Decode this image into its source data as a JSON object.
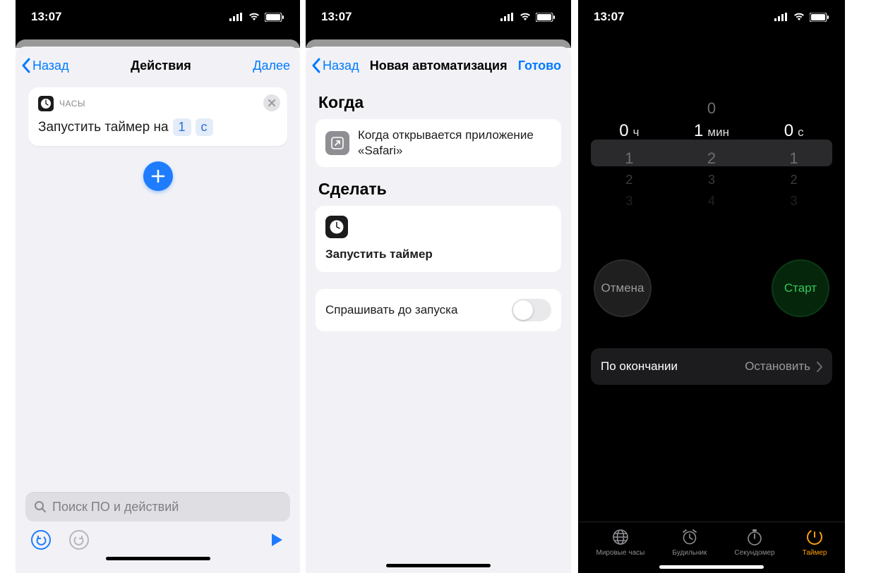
{
  "status": {
    "time": "13:07"
  },
  "screen1": {
    "nav": {
      "back": "Назад",
      "title": "Действия",
      "next": "Далее"
    },
    "card": {
      "app_label": "ЧАСЫ",
      "action_prefix": "Запустить таймер на",
      "param_value": "1",
      "param_unit": "с"
    },
    "search_placeholder": "Поиск ПО и действий"
  },
  "screen2": {
    "nav": {
      "back": "Назад",
      "title": "Новая автоматизация",
      "done": "Готово"
    },
    "when_header": "Когда",
    "when_text": "Когда открывается приложение «Safari»",
    "do_header": "Сделать",
    "do_action": "Запустить таймер",
    "ask_label": "Спрашивать до запуска"
  },
  "screen3": {
    "picker": {
      "hours_unit": "ч",
      "mins_unit": "мин",
      "secs_unit": "с",
      "hours_val": "0",
      "mins_val": "1",
      "secs_val": "0",
      "mins_above": "0",
      "h_below1": "1",
      "h_below2": "2",
      "h_below3": "3",
      "m_below1": "2",
      "m_below2": "3",
      "m_below3": "4",
      "s_below1": "1",
      "s_below2": "2",
      "s_below3": "3"
    },
    "cancel": "Отмена",
    "start": "Старт",
    "end_label": "По окончании",
    "end_value": "Остановить",
    "tabs": {
      "world": "Мировые часы",
      "alarm": "Будильник",
      "stopwatch": "Секундомер",
      "timer": "Таймер"
    }
  }
}
